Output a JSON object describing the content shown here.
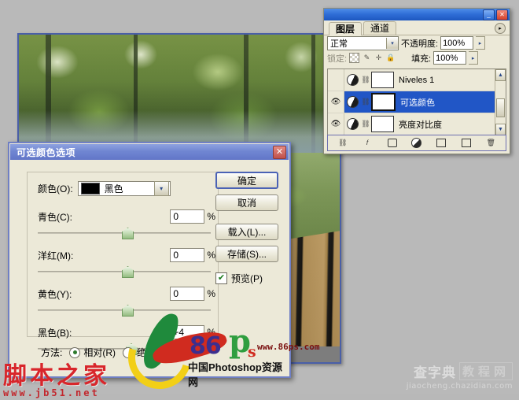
{
  "layers_palette": {
    "title_buttons": {
      "minimize": "_",
      "close": "✕"
    },
    "tabs": [
      {
        "label": "图层",
        "active": true
      },
      {
        "label": "通道",
        "active": false
      }
    ],
    "menu_icon": "▸",
    "blend_mode": {
      "label": "",
      "value": "正常",
      "arrow": "▾"
    },
    "opacity": {
      "label": "不透明度:",
      "value": "100%",
      "arrow": "▸"
    },
    "lock": {
      "label": "锁定:",
      "icons": [
        "transparency-lock-icon",
        "brush-lock-icon",
        "move-lock-icon",
        "all-lock-icon"
      ]
    },
    "fill": {
      "label": "填充:",
      "value": "100%",
      "arrow": "▸"
    },
    "rows": [
      {
        "name": "Niveles 1",
        "visible": false,
        "selected": false,
        "eye": ""
      },
      {
        "name": "可选颜色",
        "visible": true,
        "selected": true,
        "eye": "👁"
      },
      {
        "name": "亮度对比度",
        "visible": true,
        "selected": false,
        "eye": "👁"
      }
    ],
    "scroll": {
      "up": "▲",
      "down": "▼"
    },
    "bottom_icons": [
      "link-layers-icon",
      "layer-style-icon",
      "layer-mask-icon",
      "adjustment-layer-icon",
      "new-group-icon",
      "new-layer-icon",
      "delete-layer-icon"
    ]
  },
  "dialog": {
    "title": "可选颜色选项",
    "close_label": "✕",
    "color_row": {
      "label": "颜色(O):",
      "value": "黑色",
      "swatch": "#000000",
      "arrow": "▾"
    },
    "sliders": [
      {
        "label": "青色(C):",
        "value": "0",
        "unit": "%",
        "knob_percent": 50
      },
      {
        "label": "洋红(M):",
        "value": "0",
        "unit": "%",
        "knob_percent": 50
      },
      {
        "label": "黄色(Y):",
        "value": "0",
        "unit": "%",
        "knob_percent": 50
      },
      {
        "label": "黑色(B):",
        "value": "+4",
        "unit": "%",
        "knob_percent": 52
      }
    ],
    "buttons": [
      {
        "label": "确定",
        "default": true
      },
      {
        "label": "取消",
        "default": false
      },
      {
        "label": "载入(L)...",
        "default": false
      },
      {
        "label": "存储(S)...",
        "default": false
      }
    ],
    "preview": {
      "label": "预览(P)",
      "checked": true,
      "check_glyph": "✔"
    },
    "method": {
      "label": "方法:",
      "options": [
        {
          "label": "相对(R)",
          "selected": true
        },
        {
          "label": "绝对(A)",
          "selected": false
        }
      ]
    }
  },
  "watermarks": {
    "ps86": {
      "number": "86",
      "letter_p": "p",
      "letter_s": "s",
      "url": "www.86ps.com",
      "subtitle": "中国Photoshop资源网"
    },
    "jb51": {
      "text": "脚本之家",
      "url": "www.jb51.net"
    },
    "chazidian": {
      "text1": "查字典",
      "text2": "教程网",
      "url": "jiaocheng.chazidian.com"
    }
  }
}
